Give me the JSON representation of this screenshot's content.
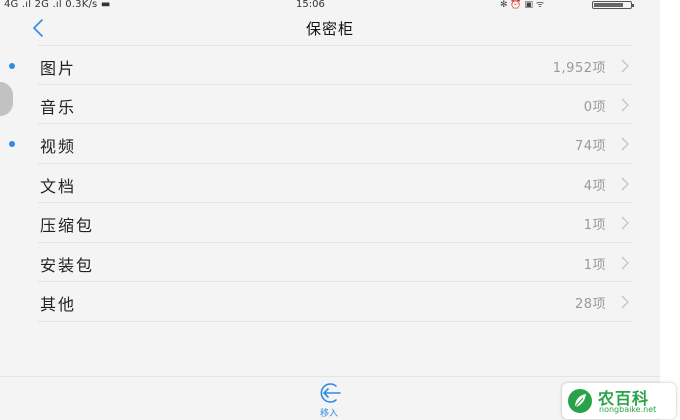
{
  "status_bar": {
    "network": "4G .ıl 2G .ıl 0.3K/s ▬",
    "time": "15:06",
    "icons": "✻ ⏰ ▣ ᯤ",
    "battery_level": 0.8
  },
  "nav": {
    "title": "保密柜",
    "back_icon": "chevron-left-icon"
  },
  "items": [
    {
      "label": "图片",
      "count": "1,952项",
      "dot": true
    },
    {
      "label": "音乐",
      "count": "0项",
      "dot": false
    },
    {
      "label": "视频",
      "count": "74项",
      "dot": true
    },
    {
      "label": "文档",
      "count": "4项",
      "dot": false
    },
    {
      "label": "压缩包",
      "count": "1项",
      "dot": false
    },
    {
      "label": "安装包",
      "count": "1项",
      "dot": false
    },
    {
      "label": "其他",
      "count": "28项",
      "dot": false
    }
  ],
  "bottom": {
    "move_label": "移入"
  },
  "watermark": {
    "title": "农百科",
    "url": "nongbaike.net"
  },
  "colors": {
    "accent": "#2f8be6",
    "brand_green": "#2aa24a"
  }
}
